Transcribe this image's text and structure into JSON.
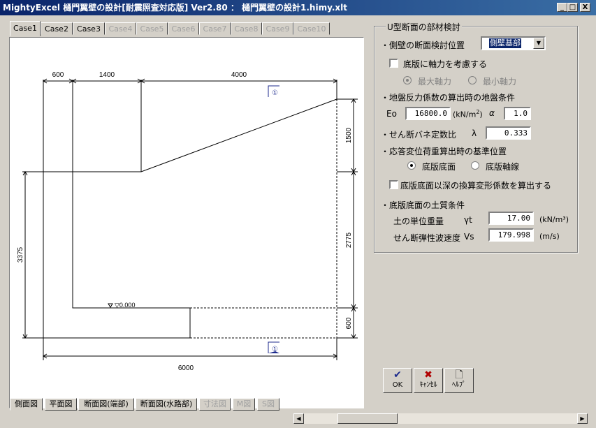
{
  "window": {
    "title": "MightyExcel 樋門翼壁の設計[耐震照査対応版] Ver2.80 ： 樋門翼壁の設計1.himy.xlt",
    "minimize": "_",
    "maximize": "□",
    "close": "X"
  },
  "case_tabs": [
    "Case1",
    "Case2",
    "Case3",
    "Case4",
    "Case5",
    "Case6",
    "Case7",
    "Case8",
    "Case9",
    "Case10"
  ],
  "view_tabs": [
    "側面図",
    "平面図",
    "断面図(端部)",
    "断面図(水路部)",
    "寸法図",
    "M図",
    "S図"
  ],
  "drawing": {
    "dim_600_top": "600",
    "dim_1400": "1400",
    "dim_4000": "4000",
    "dim_1500": "1500",
    "dim_2775": "2775",
    "dim_600_right": "600",
    "dim_3375": "3375",
    "dim_6000": "6000",
    "level": "▽0.000",
    "section_mark": "①"
  },
  "panel": {
    "group_title": "U型断面の部材検討",
    "side_wall_position_label": "・側壁の断面検討位置",
    "side_wall_position_value": "側壁基部",
    "axial_force_checkbox": "底版に軸力を考慮する",
    "axial_max": "最大軸力",
    "axial_min": "最小軸力",
    "ground_condition_label": "・地盤反力係数の算出時の地盤条件",
    "eo_label": "Eo",
    "eo_value": "16800.0",
    "eo_unit_1": "(kN/m",
    "eo_unit_exp": "2",
    "eo_unit_2": ")",
    "alpha_label": "α",
    "alpha_value": "1.0",
    "shear_spring_label": "・せん断バネ定数比",
    "lambda_label": "λ",
    "lambda_value": "0.333",
    "reference_position_label": "・応答変位荷重算出時の基準位置",
    "ref_bottom_slab_bottom": "底版底面",
    "ref_bottom_slab_axis": "底版軸線",
    "conversion_checkbox": "底版底面以深の換算変形係数を算出する",
    "soil_condition_label": "・底版底面の土質条件",
    "unit_weight_label": "土の単位重量",
    "gamma_label": "γt",
    "gamma_value": "17.00",
    "gamma_unit": "(kN/m³)",
    "vs_label": "せん断弾性波速度",
    "vs_sym": "Vs",
    "vs_value": "179.998",
    "vs_unit": "(m/s)"
  },
  "buttons": {
    "ok": "OK",
    "cancel": "ｷｬﾝｾﾙ",
    "help": "ﾍﾙﾌﾟ"
  }
}
